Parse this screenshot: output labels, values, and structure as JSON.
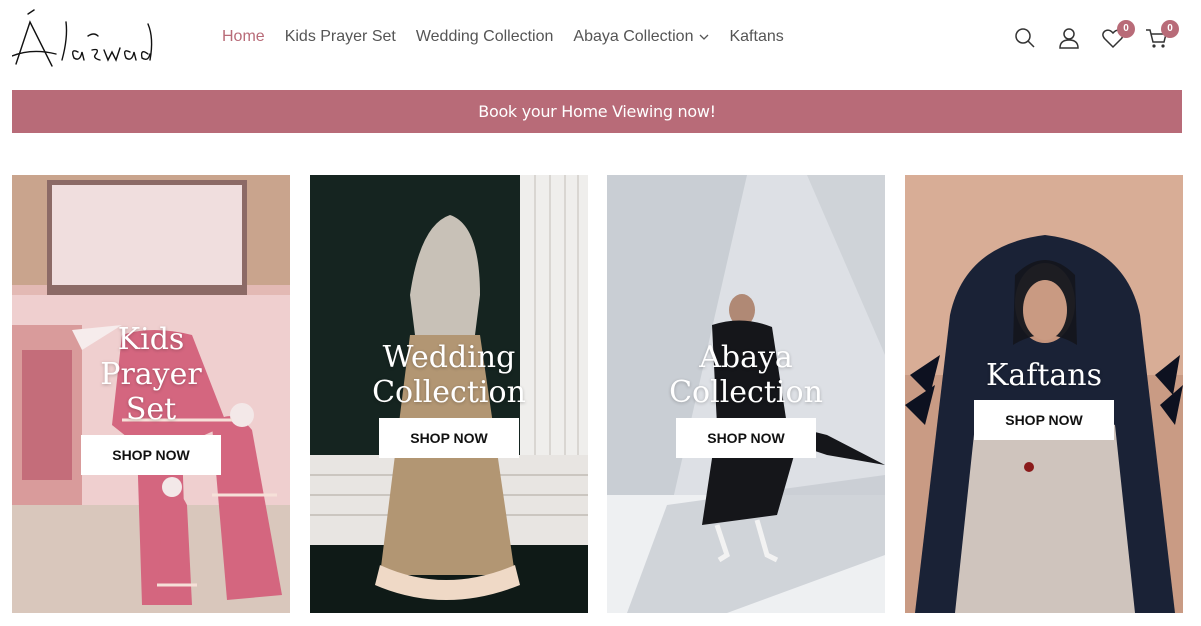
{
  "header": {
    "nav": [
      {
        "label": "Home",
        "active": true
      },
      {
        "label": "Kids Prayer Set"
      },
      {
        "label": "Wedding Collection"
      },
      {
        "label": "Abaya Collection"
      },
      {
        "label": "Kaftans"
      }
    ],
    "icons": {
      "search": "search-icon",
      "account": "user-icon",
      "wishlist": "heart-icon",
      "cart": "cart-icon"
    },
    "wishlist_count": "0",
    "cart_count": "0"
  },
  "announcement": {
    "text": "Book your Home Viewing now!"
  },
  "cards": [
    {
      "title": "Kids\nPrayer\nSet",
      "button": "SHOP NOW"
    },
    {
      "title": "Wedding\nCollection",
      "button": "SHOP NOW"
    },
    {
      "title": "Abaya\nCollection",
      "button": "SHOP NOW"
    },
    {
      "title": "Kaftans",
      "button": "SHOP NOW"
    }
  ],
  "colors": {
    "accent": "#b86b78",
    "announce_bg": "#b86b78",
    "text": "#555555"
  }
}
